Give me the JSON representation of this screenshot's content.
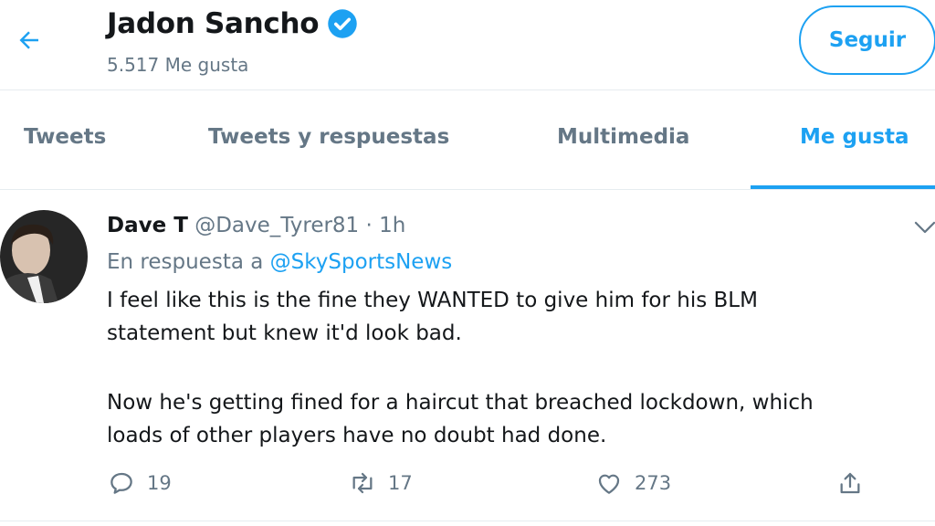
{
  "header": {
    "title": "Jadon Sancho",
    "subtitle": "5.517 Me gusta",
    "follow_label": "Seguir"
  },
  "tabs": [
    {
      "label": "Tweets",
      "active": false
    },
    {
      "label": "Tweets y respuestas",
      "active": false
    },
    {
      "label": "Multimedia",
      "active": false
    },
    {
      "label": "Me gusta",
      "active": true
    }
  ],
  "tweet": {
    "name": "Dave T",
    "handle": "@Dave_Tyrer81",
    "separator": "·",
    "time": "1h",
    "reply_prefix": "En respuesta a",
    "reply_to": "@SkySportsNews",
    "lines": [
      "I feel like this is the fine they WANTED to give him for his BLM",
      "statement but knew it'd look bad.",
      "Now he's getting fined for a haircut that breached lockdown, which",
      "loads of other players have no doubt had done."
    ],
    "reply_count": "19",
    "retweet_count": "17",
    "like_count": "273"
  },
  "colors": {
    "accent": "#1da1f2",
    "secondary_text": "#657786",
    "primary_text": "#14171a",
    "divider": "#e6ecf0"
  },
  "icons": [
    "back-arrow-icon",
    "verified-badge-icon",
    "chevron-down-icon",
    "reply-icon",
    "retweet-icon",
    "like-icon",
    "share-icon"
  ]
}
